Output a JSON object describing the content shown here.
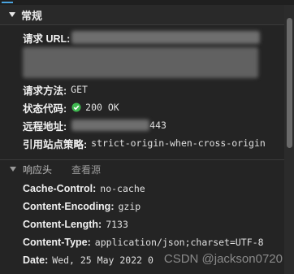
{
  "general": {
    "title": "常规",
    "request_url_label": "请求 URL:",
    "request_method_label": "请求方法:",
    "request_method_value": "GET",
    "status_code_label": "状态代码:",
    "status_code_value": "200 OK",
    "remote_address_label": "远程地址:",
    "remote_address_value": "443",
    "referrer_policy_label": "引用站点策略:",
    "referrer_policy_value": "strict-origin-when-cross-origin"
  },
  "response_headers": {
    "title": "响应头",
    "view_source": "查看源",
    "items": [
      {
        "key": "Cache-Control:",
        "value": "no-cache"
      },
      {
        "key": "Content-Encoding:",
        "value": "gzip"
      },
      {
        "key": "Content-Length:",
        "value": "7133"
      },
      {
        "key": "Content-Type:",
        "value": "application/json;charset=UTF-8"
      },
      {
        "key": "Date:",
        "value": "Wed, 25 May 2022 0"
      }
    ]
  },
  "watermark": "CSDN @jackson0720",
  "colors": {
    "status_ok": "#3fb950",
    "accent": "#4aa3df"
  }
}
